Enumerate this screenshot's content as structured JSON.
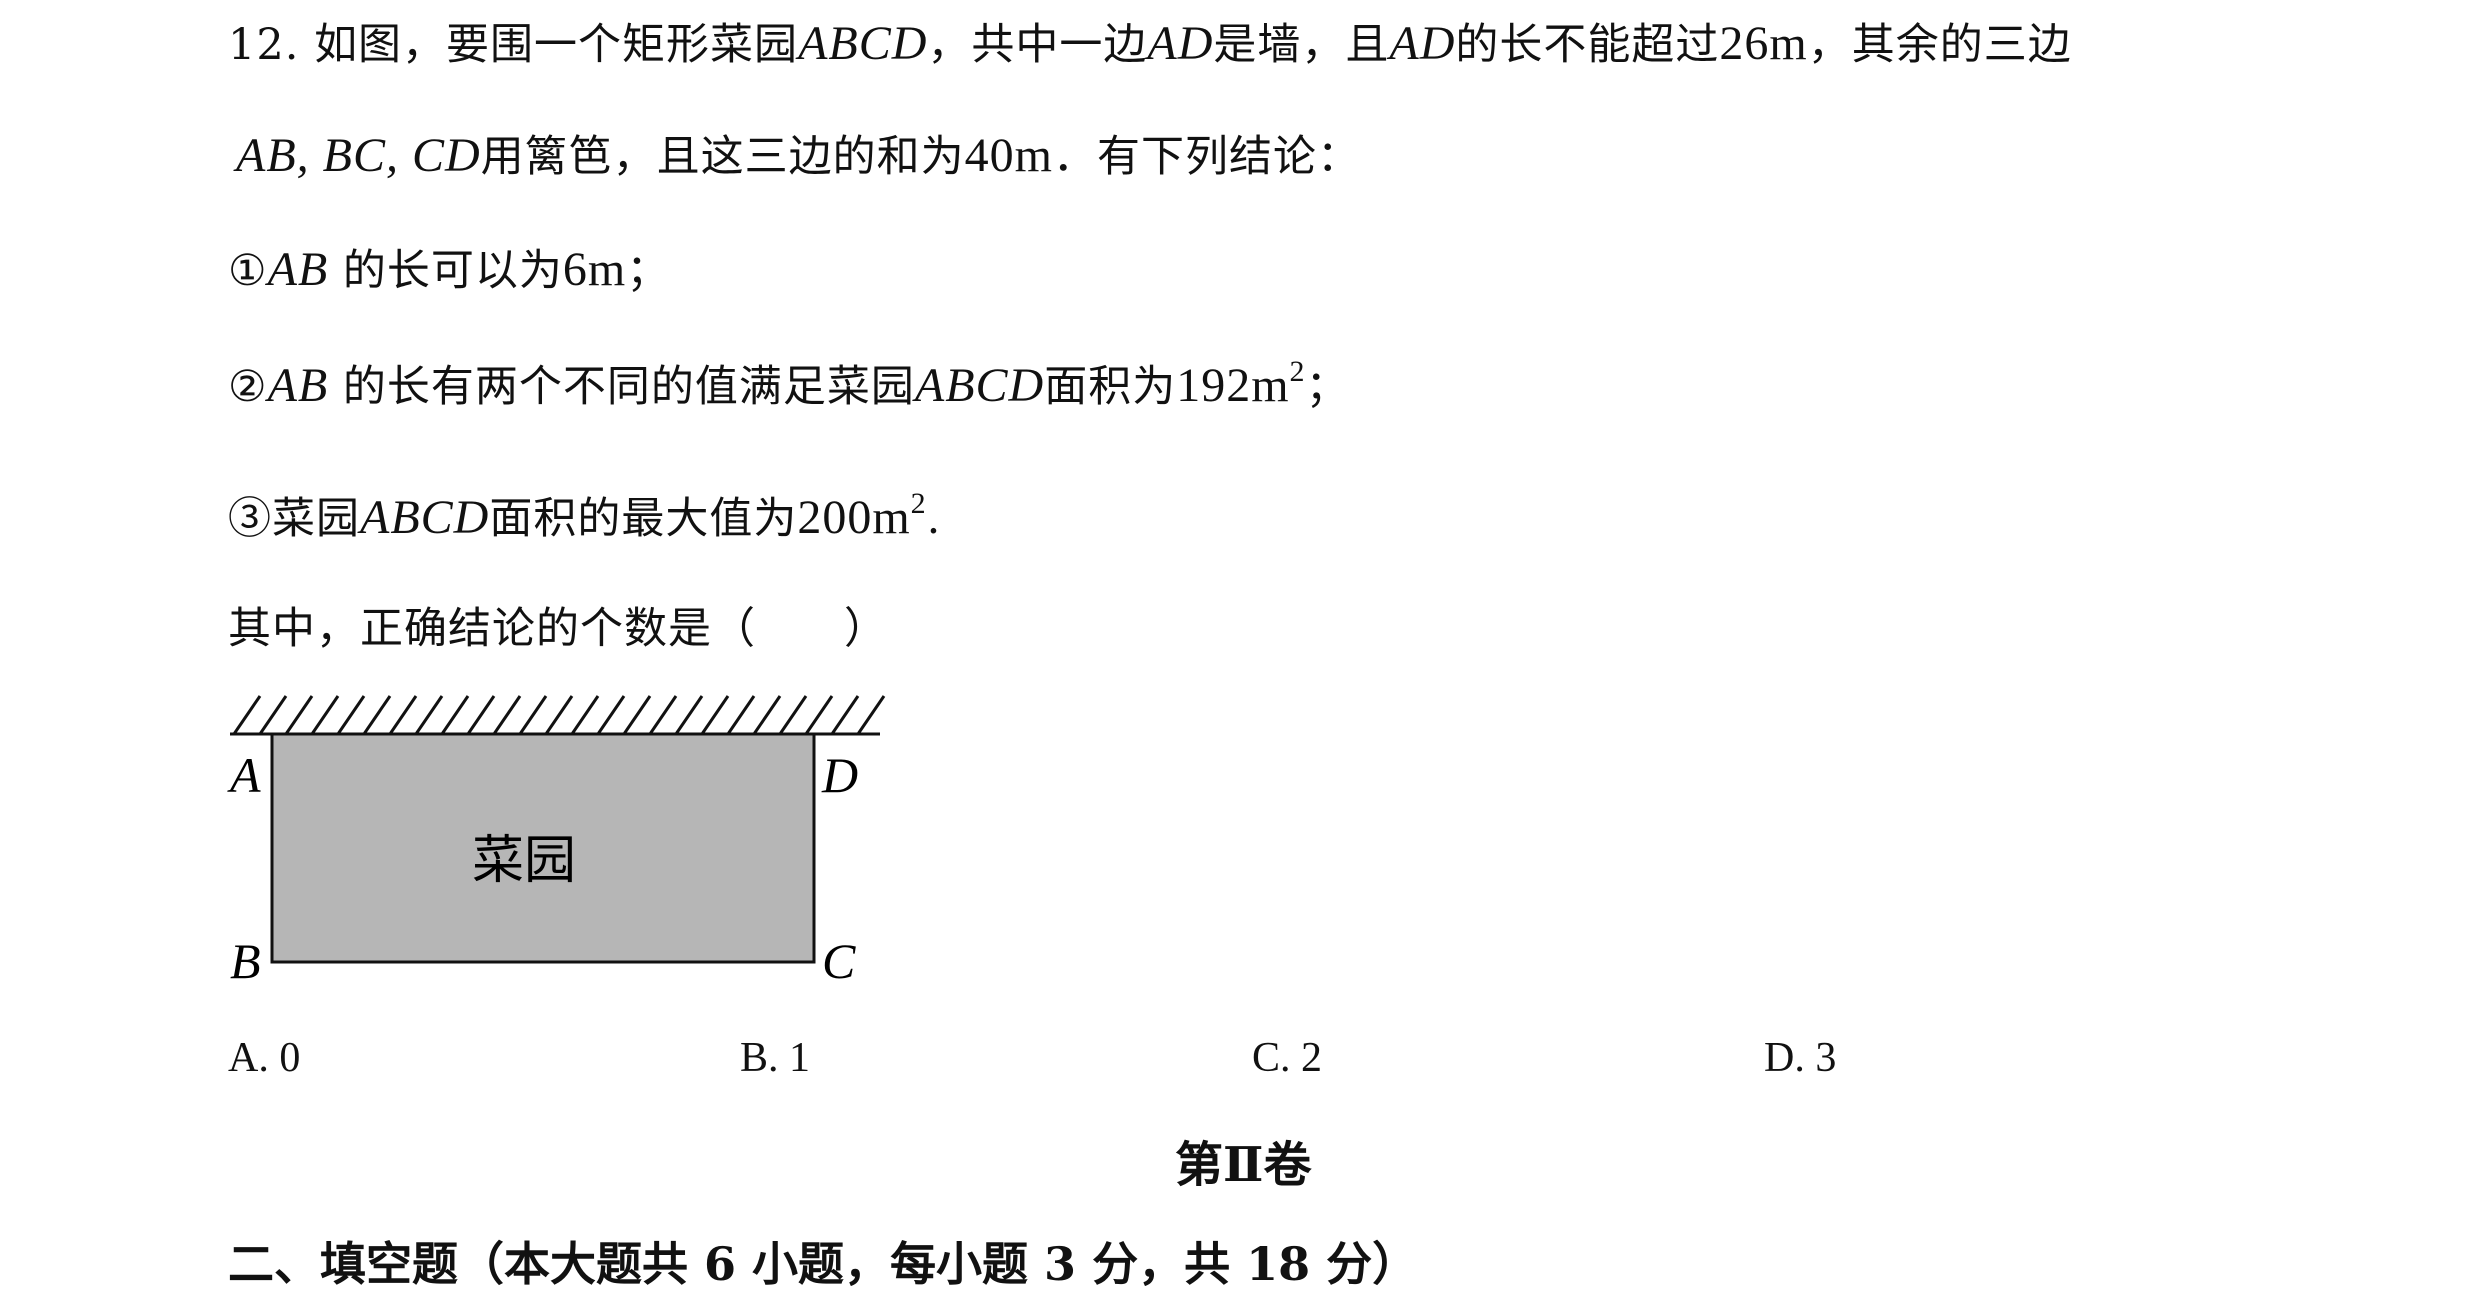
{
  "question": {
    "number": "12.",
    "line1": {
      "t1": "如图，要围一个矩形菜园",
      "m1": "ABCD",
      "t2": "，共中一边",
      "m2": "AD",
      "t3": "是墙，且",
      "m3": "AD",
      "t4": "的长不能超过",
      "v1": "26m",
      "t5": "，其余的三边"
    },
    "line2": {
      "m1": "AB, BC, CD",
      "t1": "用篱笆，且这三边的和为",
      "v1": "40m",
      "t2": "．有下列结论："
    },
    "stmt1": {
      "marker": "①",
      "m1": "AB",
      "t1": "的长可以为",
      "v1": "6m",
      "t2": "；"
    },
    "stmt2": {
      "marker": "②",
      "m1": "AB",
      "t1": "的长有两个不同的值满足菜园",
      "m2": "ABCD",
      "t2": "面积为",
      "v1": "192m",
      "exp": "2",
      "t3": "；"
    },
    "stmt3": {
      "marker": "③",
      "t0": "菜园",
      "m1": "ABCD",
      "t1": "面积的最大值为",
      "v1": "200m",
      "exp": "2",
      "t2": "."
    },
    "prompt": "其中，正确结论的个数是（　　）"
  },
  "figure": {
    "garden_label": "菜园",
    "labels": {
      "A": "A",
      "B": "B",
      "C": "C",
      "D": "D"
    },
    "fill_color": "#b6b6b6",
    "stroke_color": "#111111"
  },
  "choices": [
    {
      "label": "A. 0"
    },
    {
      "label": "B. 1"
    },
    {
      "label": "C. 2"
    },
    {
      "label": "D. 3"
    }
  ],
  "section": {
    "title": "第Ⅱ卷",
    "part_title": "二、填空题（本大题共 6 小题，每小题 3 分，共 18 分）"
  }
}
